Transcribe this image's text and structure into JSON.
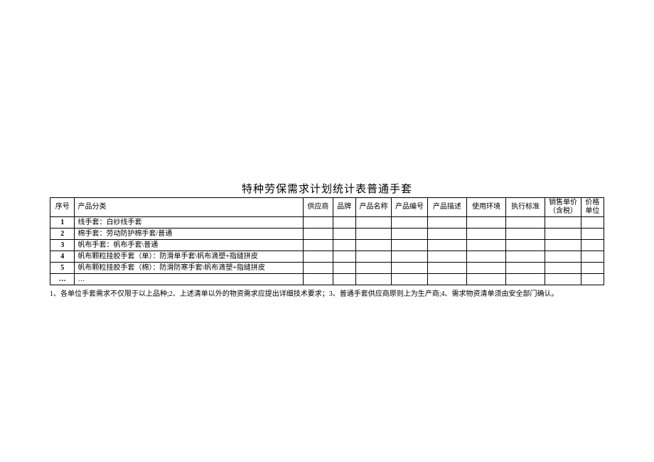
{
  "title": "特种劳保需求计划统计表普通手套",
  "headers": {
    "seq": "序号",
    "category": "产品分类",
    "supplier": "供应商",
    "brand": "品牌",
    "prodname": "产品名称",
    "prodno": "产品编号",
    "desc": "产品描述",
    "env": "使用环境",
    "std": "执行标准",
    "price": "销售单价（含税）",
    "unit": "价格单位"
  },
  "rows": [
    {
      "seq": "1",
      "category": "线手套：白纱线手套"
    },
    {
      "seq": "2",
      "category": "棉手套：劳动防护棉手套/普通"
    },
    {
      "seq": "3",
      "category": "帆布手套：帆布手套\\普通"
    },
    {
      "seq": "4",
      "category": "帆布颗粒挂胶手套（单）：防滑单手套\\帆布滴塑+指缝拼皮"
    },
    {
      "seq": "5",
      "category": "帆布颗粒挂胶手套（棉）：防滑防寒手套\\帆布滴塑+指缝拼皮"
    },
    {
      "seq": "…",
      "category": "…"
    }
  ],
  "footnote": "1、各单位手套需求不仅限于以上品种;2、上述清单以外的物资需求应提出详细技术要求；3、普通手套供应商原则上为生产商;4、需求物资清单须由安全部门确认。"
}
